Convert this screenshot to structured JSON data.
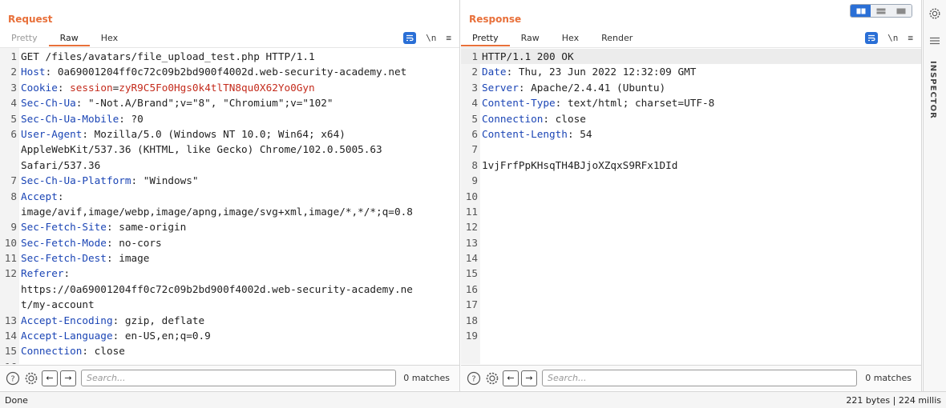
{
  "request": {
    "title": "Request",
    "tabs": [
      "Pretty",
      "Raw",
      "Hex"
    ],
    "active_tab": "Raw",
    "lines": [
      {
        "n": "1",
        "parts": [
          {
            "t": "GET /files/avatars/file_upload_test.php HTTP/1.1",
            "c": "plain"
          }
        ]
      },
      {
        "n": "2",
        "parts": [
          {
            "t": "Host",
            "c": "hname"
          },
          {
            "t": ": 0a69001204ff0c72c09b2bd900f4002d.web-security-academy.net",
            "c": "plain"
          }
        ]
      },
      {
        "n": "3",
        "parts": [
          {
            "t": "Cookie",
            "c": "hname"
          },
          {
            "t": ": ",
            "c": "plain"
          },
          {
            "t": "session",
            "c": "cookie"
          },
          {
            "t": "=",
            "c": "plain"
          },
          {
            "t": "zyR9C5Fo0Hgs0k4tlTN8qu0X62Yo0Gyn",
            "c": "cookie"
          }
        ]
      },
      {
        "n": "4",
        "parts": [
          {
            "t": "Sec-Ch-Ua",
            "c": "hname"
          },
          {
            "t": ": \"-Not.A/Brand\";v=\"8\", \"Chromium\";v=\"102\"",
            "c": "plain"
          }
        ]
      },
      {
        "n": "5",
        "parts": [
          {
            "t": "Sec-Ch-Ua-Mobile",
            "c": "hname"
          },
          {
            "t": ": ?0",
            "c": "plain"
          }
        ]
      },
      {
        "n": "6",
        "parts": [
          {
            "t": "User-Agent",
            "c": "hname"
          },
          {
            "t": ": Mozilla/5.0 (Windows NT 10.0; Win64; x64)",
            "c": "plain"
          }
        ]
      },
      {
        "n": "",
        "parts": [
          {
            "t": "AppleWebKit/537.36 (KHTML, like Gecko) Chrome/102.0.5005.63",
            "c": "plain"
          }
        ]
      },
      {
        "n": "",
        "parts": [
          {
            "t": "Safari/537.36",
            "c": "plain"
          }
        ]
      },
      {
        "n": "7",
        "parts": [
          {
            "t": "Sec-Ch-Ua-Platform",
            "c": "hname"
          },
          {
            "t": ": \"Windows\"",
            "c": "plain"
          }
        ]
      },
      {
        "n": "8",
        "parts": [
          {
            "t": "Accept",
            "c": "hname"
          },
          {
            "t": ":",
            "c": "plain"
          }
        ]
      },
      {
        "n": "",
        "parts": [
          {
            "t": "image/avif,image/webp,image/apng,image/svg+xml,image/*,*/*;q=0.8",
            "c": "plain"
          }
        ]
      },
      {
        "n": "9",
        "parts": [
          {
            "t": "Sec-Fetch-Site",
            "c": "hname"
          },
          {
            "t": ": same-origin",
            "c": "plain"
          }
        ]
      },
      {
        "n": "10",
        "parts": [
          {
            "t": "Sec-Fetch-Mode",
            "c": "hname"
          },
          {
            "t": ": no-cors",
            "c": "plain"
          }
        ]
      },
      {
        "n": "11",
        "parts": [
          {
            "t": "Sec-Fetch-Dest",
            "c": "hname"
          },
          {
            "t": ": image",
            "c": "plain"
          }
        ]
      },
      {
        "n": "12",
        "parts": [
          {
            "t": "Referer",
            "c": "hname"
          },
          {
            "t": ":",
            "c": "plain"
          }
        ]
      },
      {
        "n": "",
        "parts": [
          {
            "t": "https://0a69001204ff0c72c09b2bd900f4002d.web-security-academy.ne",
            "c": "plain"
          }
        ]
      },
      {
        "n": "",
        "parts": [
          {
            "t": "t/my-account",
            "c": "plain"
          }
        ]
      },
      {
        "n": "13",
        "parts": [
          {
            "t": "Accept-Encoding",
            "c": "hname"
          },
          {
            "t": ": gzip, deflate",
            "c": "plain"
          }
        ]
      },
      {
        "n": "14",
        "parts": [
          {
            "t": "Accept-Language",
            "c": "hname"
          },
          {
            "t": ": en-US,en;q=0.9",
            "c": "plain"
          }
        ]
      },
      {
        "n": "15",
        "parts": [
          {
            "t": "Connection",
            "c": "hname"
          },
          {
            "t": ": close",
            "c": "plain"
          }
        ]
      },
      {
        "n": "16",
        "parts": [
          {
            "t": "",
            "c": "plain"
          }
        ]
      }
    ],
    "search_placeholder": "Search...",
    "matches": "0 matches"
  },
  "response": {
    "title": "Response",
    "tabs": [
      "Pretty",
      "Raw",
      "Hex",
      "Render"
    ],
    "active_tab": "Pretty",
    "lines": [
      {
        "n": "1",
        "parts": [
          {
            "t": "HTTP/1.1 200 OK",
            "c": "plain"
          }
        ]
      },
      {
        "n": "2",
        "parts": [
          {
            "t": "Date",
            "c": "hname"
          },
          {
            "t": ": Thu, 23 Jun 2022 12:32:09 GMT",
            "c": "plain"
          }
        ]
      },
      {
        "n": "3",
        "parts": [
          {
            "t": "Server",
            "c": "hname"
          },
          {
            "t": ": Apache/2.4.41 (Ubuntu)",
            "c": "plain"
          }
        ]
      },
      {
        "n": "4",
        "parts": [
          {
            "t": "Content-Type",
            "c": "hname"
          },
          {
            "t": ": text/html; charset=UTF-8",
            "c": "plain"
          }
        ]
      },
      {
        "n": "5",
        "parts": [
          {
            "t": "Connection",
            "c": "hname"
          },
          {
            "t": ": close",
            "c": "plain"
          }
        ]
      },
      {
        "n": "6",
        "parts": [
          {
            "t": "Content-Length",
            "c": "hname"
          },
          {
            "t": ": 54",
            "c": "plain"
          }
        ]
      },
      {
        "n": "7",
        "parts": [
          {
            "t": "",
            "c": "plain"
          }
        ]
      },
      {
        "n": "8",
        "parts": [
          {
            "t": "1vjFrfPpKHsqTH4BJjoXZqxS9RFx1DId",
            "c": "plain"
          }
        ]
      },
      {
        "n": "9",
        "parts": [
          {
            "t": "",
            "c": "plain"
          }
        ]
      },
      {
        "n": "10",
        "parts": [
          {
            "t": "",
            "c": "plain"
          }
        ]
      },
      {
        "n": "11",
        "parts": [
          {
            "t": "",
            "c": "plain"
          }
        ]
      },
      {
        "n": "12",
        "parts": [
          {
            "t": "",
            "c": "plain"
          }
        ]
      },
      {
        "n": "13",
        "parts": [
          {
            "t": "",
            "c": "plain"
          }
        ]
      },
      {
        "n": "14",
        "parts": [
          {
            "t": "",
            "c": "plain"
          }
        ]
      },
      {
        "n": "15",
        "parts": [
          {
            "t": "",
            "c": "plain"
          }
        ]
      },
      {
        "n": "16",
        "parts": [
          {
            "t": "",
            "c": "plain"
          }
        ]
      },
      {
        "n": "17",
        "parts": [
          {
            "t": "",
            "c": "plain"
          }
        ]
      },
      {
        "n": "18",
        "parts": [
          {
            "t": "",
            "c": "plain"
          }
        ]
      },
      {
        "n": "19",
        "parts": [
          {
            "t": "",
            "c": "plain"
          }
        ]
      }
    ],
    "search_placeholder": "Search...",
    "matches": "0 matches"
  },
  "toolbar_icons": {
    "newline": "\\n",
    "menu": "≡",
    "help": "?",
    "prev": "←",
    "next": "→"
  },
  "inspector": {
    "label": "INSPECTOR"
  },
  "status": {
    "left": "Done",
    "right": "221 bytes | 224 millis"
  },
  "colors": {
    "accent": "#e8703a",
    "header_name": "#1b45b5",
    "cookie": "#c42b1c",
    "toggle_blue": "#2a6fd6"
  }
}
